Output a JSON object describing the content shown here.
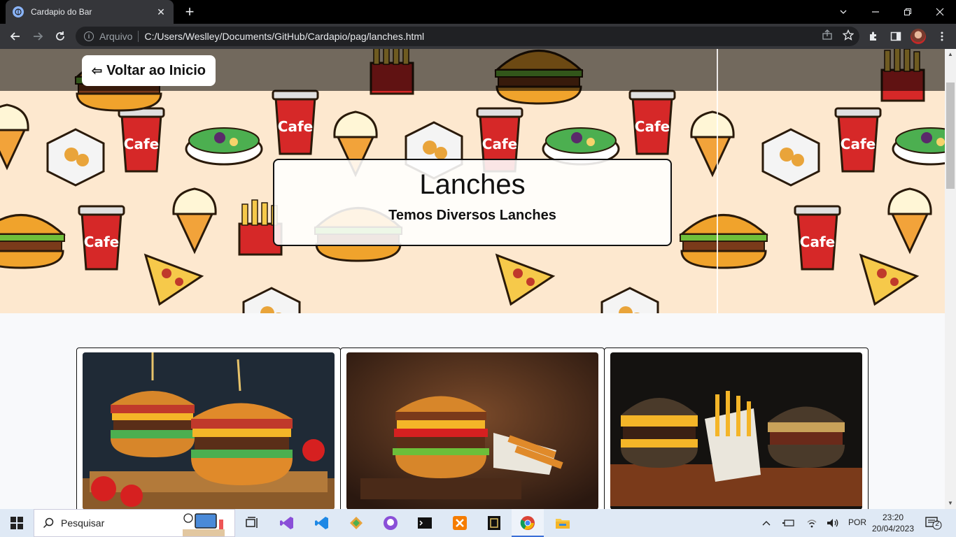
{
  "browser": {
    "tab_title": "Cardapio do Bar",
    "address_scheme": "Arquivo",
    "address_url": "C:/Users/Weslley/Documents/GitHub/Cardapio/pag/lanches.html"
  },
  "page": {
    "back_button_label": "Voltar ao Inicio",
    "back_arrow": "⇦",
    "title": "Lanches",
    "subtitle": "Temos Diversos Lanches",
    "cards": [
      {
        "image": "burger-photo"
      },
      {
        "image": "burger-photo"
      },
      {
        "image": "burger-photo"
      }
    ]
  },
  "taskbar": {
    "search_placeholder": "Pesquisar",
    "language": "POR",
    "time": "23:20",
    "date": "20/04/2023",
    "notification_count": "2"
  },
  "colors": {
    "hero_bg": "#fde8cf",
    "accent": "#3a6fd8"
  }
}
